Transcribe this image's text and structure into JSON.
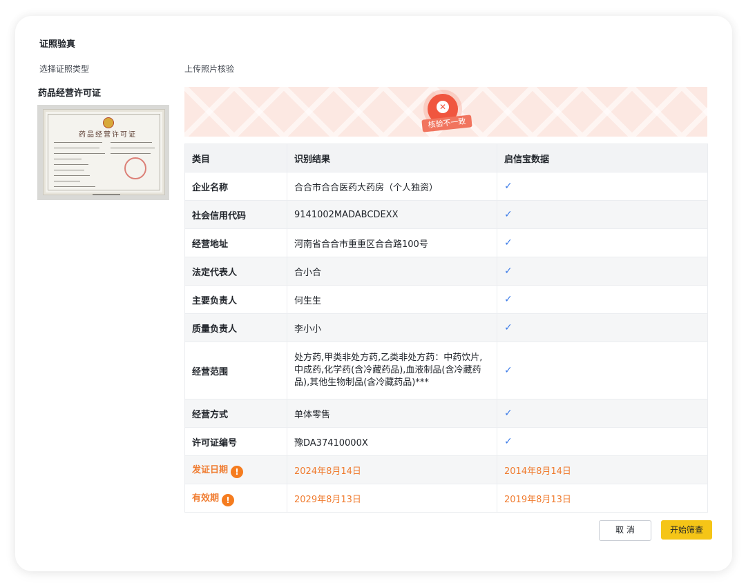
{
  "header": {
    "title": "证照验真",
    "select_label": "选择证照类型",
    "upload_label": "上传照片核验"
  },
  "license": {
    "type": "药品经营许可证",
    "image_title": "药品经营许可证"
  },
  "verification": {
    "status_text": "核验不一致",
    "status_icon": "close-icon",
    "status_color": "#f0563f"
  },
  "table": {
    "headers": [
      "类目",
      "识别结果",
      "启信宝数据"
    ],
    "rows": [
      {
        "category": "企业名称",
        "result": "合合市合合医药大药房（个人独资）",
        "qixin": "✓",
        "warn": false
      },
      {
        "category": "社会信用代码",
        "result": "9141002MADABCDEXX",
        "qixin": "✓",
        "warn": false
      },
      {
        "category": "经营地址",
        "result": "河南省合合市重重区合合路100号",
        "qixin": "✓",
        "warn": false
      },
      {
        "category": "法定代表人",
        "result": "合小合",
        "qixin": "✓",
        "warn": false
      },
      {
        "category": "主要负责人",
        "result": "何生生",
        "qixin": "✓",
        "warn": false
      },
      {
        "category": "质量负责人",
        "result": "李小小",
        "qixin": "✓",
        "warn": false
      },
      {
        "category": "经营范围",
        "result": "处方药,甲类非处方药,乙类非处方药：中药饮片,中成药,化学药(含冷藏药品),血液制品(含冷藏药品),其他生物制品(含冷藏药品)***",
        "qixin": "✓",
        "warn": false
      },
      {
        "category": "经营方式",
        "result": "单体零售",
        "qixin": "✓",
        "warn": false
      },
      {
        "category": "许可证编号",
        "result": "豫DA37410000X",
        "qixin": "✓",
        "warn": false
      },
      {
        "category": "发证日期",
        "result": "2024年8月14日",
        "qixin": "2014年8月14日",
        "warn": true,
        "warn_icon": "!"
      },
      {
        "category": "有效期",
        "result": "2029年8月13日",
        "qixin": "2019年8月13日",
        "warn": true,
        "warn_icon": "!"
      }
    ],
    "check_color": "#3b7be8",
    "warn_color": "#f07c30"
  },
  "footer": {
    "cancel_label": "取 消",
    "start_label": "开始筛查",
    "accent": "#f5c517"
  }
}
